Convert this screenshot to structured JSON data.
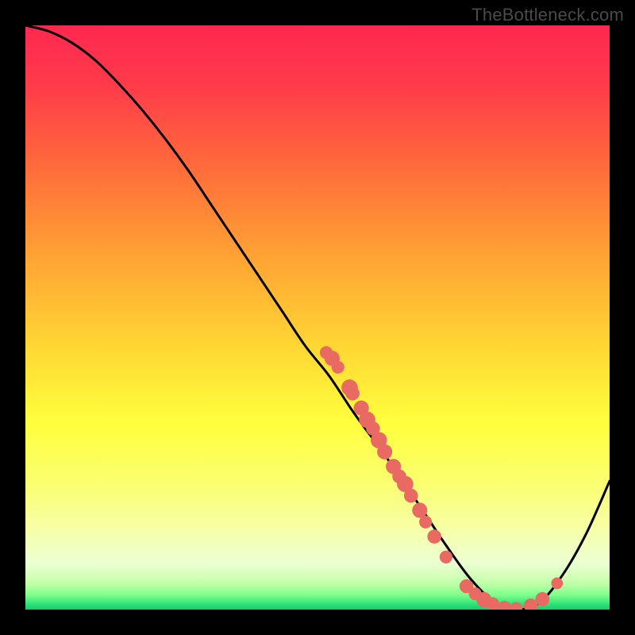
{
  "watermark": "TheBottleneck.com",
  "chart_data": {
    "type": "line",
    "title": "",
    "xlabel": "",
    "ylabel": "",
    "xlim": [
      0,
      100
    ],
    "ylim": [
      0,
      100
    ],
    "gradient_stops": [
      {
        "offset": 0.0,
        "color": "#ff2850"
      },
      {
        "offset": 0.1,
        "color": "#ff3a4a"
      },
      {
        "offset": 0.25,
        "color": "#ff6e3a"
      },
      {
        "offset": 0.4,
        "color": "#ffa433"
      },
      {
        "offset": 0.55,
        "color": "#ffd733"
      },
      {
        "offset": 0.68,
        "color": "#ffff3c"
      },
      {
        "offset": 0.78,
        "color": "#fbff6e"
      },
      {
        "offset": 0.86,
        "color": "#f7ffa6"
      },
      {
        "offset": 0.92,
        "color": "#ecffd2"
      },
      {
        "offset": 0.955,
        "color": "#c2ffaa"
      },
      {
        "offset": 0.975,
        "color": "#7dff8a"
      },
      {
        "offset": 0.99,
        "color": "#2fe57a"
      },
      {
        "offset": 1.0,
        "color": "#1cc96a"
      }
    ],
    "series": [
      {
        "name": "curve",
        "x": [
          0,
          4,
          8,
          12,
          16,
          20,
          24,
          28,
          32,
          36,
          40,
          44,
          48,
          52,
          56,
          60,
          64,
          68,
          72,
          76,
          80,
          84,
          88,
          92,
          96,
          100
        ],
        "y": [
          100,
          99,
          97,
          94,
          90,
          85.5,
          80.5,
          75,
          69,
          63,
          57,
          51,
          45,
          40,
          34,
          28.5,
          23,
          17,
          11,
          5.5,
          1.5,
          0,
          1.2,
          6,
          13,
          22
        ]
      }
    ],
    "scatter_points": [
      {
        "x": 51.5,
        "y": 44.0,
        "r": 1.1
      },
      {
        "x": 52.5,
        "y": 43.0,
        "r": 1.3
      },
      {
        "x": 53.5,
        "y": 41.5,
        "r": 1.1
      },
      {
        "x": 55.5,
        "y": 38.0,
        "r": 1.4
      },
      {
        "x": 56.0,
        "y": 37.0,
        "r": 1.2
      },
      {
        "x": 57.5,
        "y": 34.5,
        "r": 1.3
      },
      {
        "x": 58.5,
        "y": 32.5,
        "r": 1.4
      },
      {
        "x": 59.5,
        "y": 31.0,
        "r": 1.2
      },
      {
        "x": 60.5,
        "y": 29.0,
        "r": 1.4
      },
      {
        "x": 61.5,
        "y": 27.0,
        "r": 1.3
      },
      {
        "x": 63.0,
        "y": 24.5,
        "r": 1.3
      },
      {
        "x": 64.0,
        "y": 22.8,
        "r": 1.2
      },
      {
        "x": 65.0,
        "y": 21.5,
        "r": 1.4
      },
      {
        "x": 66.0,
        "y": 19.5,
        "r": 1.2
      },
      {
        "x": 67.5,
        "y": 17.0,
        "r": 1.3
      },
      {
        "x": 68.5,
        "y": 15.0,
        "r": 1.1
      },
      {
        "x": 70.0,
        "y": 12.5,
        "r": 1.2
      },
      {
        "x": 72.0,
        "y": 9.0,
        "r": 1.1
      },
      {
        "x": 75.5,
        "y": 4.0,
        "r": 1.2
      },
      {
        "x": 77.0,
        "y": 2.7,
        "r": 1.1
      },
      {
        "x": 78.5,
        "y": 1.7,
        "r": 1.3
      },
      {
        "x": 80.0,
        "y": 1.0,
        "r": 1.1
      },
      {
        "x": 82.0,
        "y": 0.3,
        "r": 1.2
      },
      {
        "x": 84.0,
        "y": 0.2,
        "r": 1.1
      },
      {
        "x": 86.5,
        "y": 0.7,
        "r": 1.2
      },
      {
        "x": 88.5,
        "y": 1.8,
        "r": 1.2
      },
      {
        "x": 91.0,
        "y": 4.5,
        "r": 1.0
      }
    ],
    "point_color": "#e96a62"
  }
}
